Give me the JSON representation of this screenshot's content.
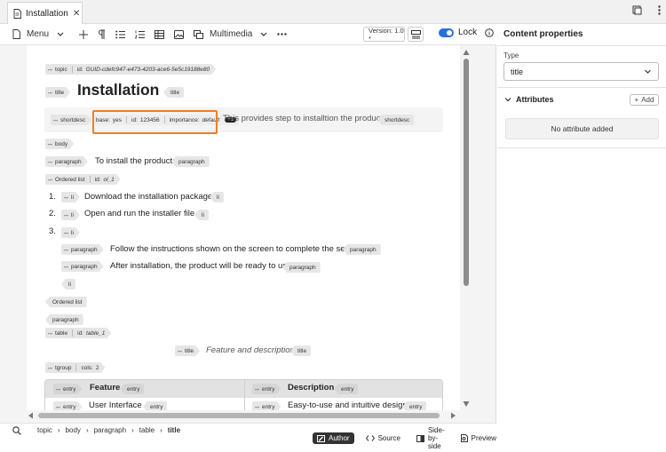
{
  "tab": {
    "title": "Installation",
    "close": "✕"
  },
  "toolbar": {
    "menu": "Menu",
    "multimedia": "Multimedia",
    "version": "Version: 1.0 *",
    "lock": "Lock"
  },
  "doc": {
    "topic_tag": "topic",
    "topic_id_label": "id:",
    "topic_id": "GUID-cdefc947-e473-4203-ace6-5e5c19188e80",
    "title_tag": "title",
    "title_text": "Installation",
    "title_end": "title",
    "shortdesc_tag": "shortdesc",
    "base_label": "base:",
    "base_val": "yes",
    "sd_id_label": "id:",
    "sd_id": "123456",
    "importance_label": "importance:",
    "importance_val": "default",
    "more_badge": "+1",
    "shortdesc_text": "This provides step to installtion the product.",
    "shortdesc_end": "shortdesc",
    "body_tag": "body",
    "p1_tag": "paragraph",
    "p1_text": "To install the product:",
    "p1_end": "paragraph",
    "ol_tag": "Ordered list",
    "ol_id_label": "id:",
    "ol_id": "ol_1",
    "li1_num": "1.",
    "li_tag": "li",
    "li1_text": "Download the installation package.",
    "li_end": "li",
    "li2_num": "2.",
    "li2_text": "Open and run the installer file.",
    "li3_num": "3.",
    "p2_text": "Follow the instructions shown on the screen to complete the setup.",
    "p3_text": "After installation, the product will be ready to use.",
    "ol_end": "Ordered list",
    "p_end": "paragraph",
    "table_tag": "table",
    "table_id_label": "id:",
    "table_id": "table_1",
    "table_title_tag": "title",
    "table_title_text": "Feature and description",
    "table_title_end": "title",
    "tgroup_tag": "tgroup",
    "tgroup_cols_label": "cols:",
    "tgroup_cols": "2",
    "entry_tag": "entry",
    "h1": "Feature",
    "h2": "Description",
    "r1c1": "User Interface",
    "r1c2": "Easy-to-use and intuitive design"
  },
  "status": {
    "crumbs": [
      "topic",
      "body",
      "paragraph",
      "table"
    ],
    "current": "title",
    "author": "Author",
    "source": "Source",
    "side": "Side-by-side",
    "preview": "Preview"
  },
  "panel": {
    "title": "Content properties",
    "type_label": "Type",
    "type_value": "title",
    "attributes": "Attributes",
    "add": "Add",
    "no_attr": "No attribute added"
  }
}
